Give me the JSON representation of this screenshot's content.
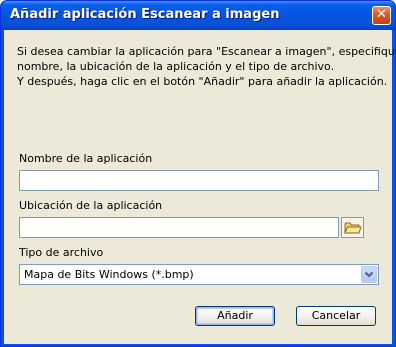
{
  "window": {
    "title": "Añadir aplicación Escanear a imagen",
    "close_symbol": "✕"
  },
  "message": {
    "lines": [
      "Si desea cambiar la aplicación para \"Escanear a imagen\", especifique el",
      "nombre, la ubicación de la aplicación y el tipo de archivo.",
      "Y después, haga clic en el botón \"Añadir\" para añadir la aplicación."
    ]
  },
  "fields": {
    "app_name": {
      "label": "Nombre de la aplicación",
      "value": ""
    },
    "app_location": {
      "label": "Ubicación de la aplicación",
      "value": ""
    },
    "file_type": {
      "label": "Tipo de archivo",
      "selected": "Mapa de Bits Windows (*.bmp)"
    }
  },
  "buttons": {
    "add": "Añadir",
    "cancel": "Cancelar"
  },
  "icons": {
    "close": "close-icon",
    "browse": "folder-icon",
    "dropdown": "chevron-down-icon"
  },
  "colors": {
    "titlebar": "#0554e0",
    "dialog_bg": "#ece9d8",
    "close_button": "#e0572b",
    "field_border": "#7f9db9"
  }
}
